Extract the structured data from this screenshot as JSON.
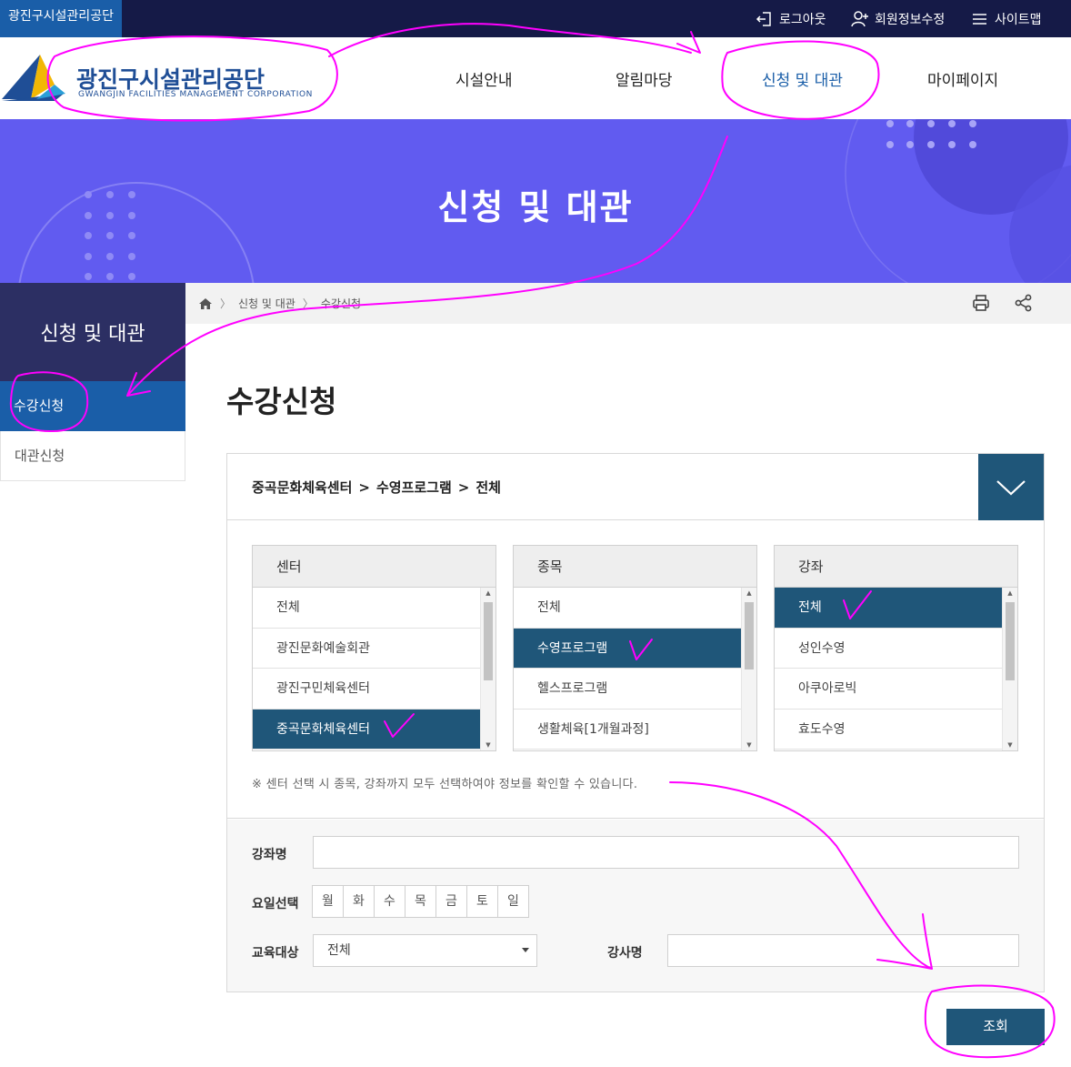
{
  "topbar": {
    "org_tag": "광진구시설관리공단",
    "logout": "로그아웃",
    "member_edit": "회원정보수정",
    "sitemap": "사이트맵"
  },
  "header": {
    "logo_ko": "광진구시설관리공단",
    "logo_en": "GWANGJIN FACILITIES MANAGEMENT CORPORATION",
    "nav": [
      "시설안내",
      "알림마당",
      "신청 및 대관",
      "마이페이지"
    ]
  },
  "banner": {
    "title": "신청 및 대관"
  },
  "sidebar": {
    "title": "신청 및 대관",
    "items": [
      "수강신청",
      "대관신청"
    ]
  },
  "breadcrumb": {
    "items": [
      "신청 및 대관",
      "수강신청"
    ]
  },
  "page": {
    "title": "수강신청"
  },
  "selection_path": [
    "중곡문화체육센터",
    "수영프로그램",
    "전체"
  ],
  "path_separator": ">",
  "lists": {
    "center": {
      "header": "센터",
      "items": [
        "전체",
        "광진문화예술회관",
        "광진구민체육센터",
        "중곡문화체육센터"
      ]
    },
    "category": {
      "header": "종목",
      "items": [
        "전체",
        "수영프로그램",
        "헬스프로그램",
        "생활체육[1개월과정]"
      ]
    },
    "course": {
      "header": "강좌",
      "items": [
        "전체",
        "성인수영",
        "아쿠아로빅",
        "효도수영"
      ]
    }
  },
  "notice": "※ 센터 선택 시 종목, 강좌까지 모두 선택하여야 정보를 확인할 수 있습니다.",
  "form": {
    "course_name_label": "강좌명",
    "day_label": "요일선택",
    "days": [
      "월",
      "화",
      "수",
      "목",
      "금",
      "토",
      "일"
    ],
    "target_label": "교육대상",
    "target_value": "전체",
    "teacher_label": "강사명",
    "search_button": "조회"
  },
  "colors": {
    "topbar": "#151a47",
    "primary_blue": "#1a5ea8",
    "banner": "#615bf0",
    "dark_teal": "#1f5679",
    "annotation": "#ff00ff"
  }
}
